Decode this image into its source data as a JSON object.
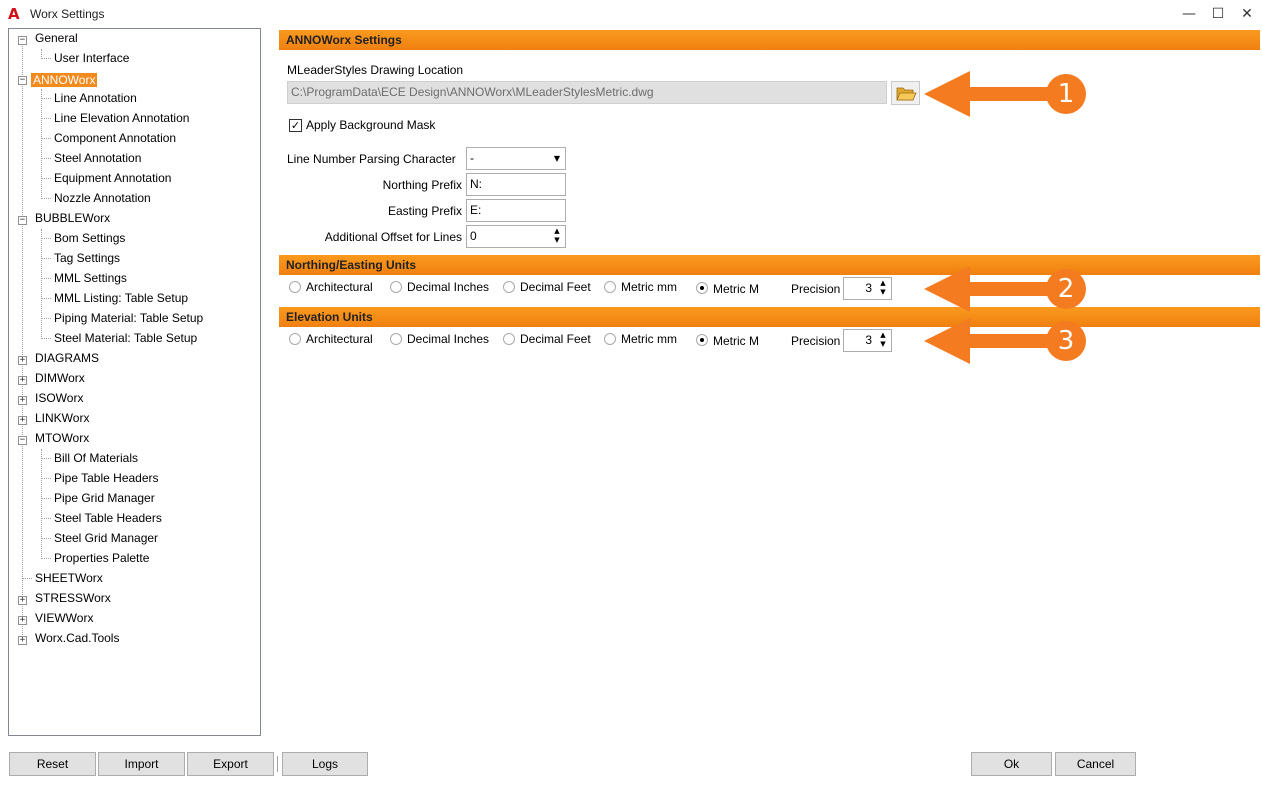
{
  "window": {
    "title": "Worx Settings",
    "app_icon": "A",
    "minimize": "—",
    "maximize": "☐",
    "close": "✕"
  },
  "tree": {
    "general": "General",
    "user_interface": "User Interface",
    "annoworx": "ANNOWorx",
    "anno_children": [
      "Line Annotation",
      "Line Elevation Annotation",
      "Component Annotation",
      "Steel Annotation",
      "Equipment Annotation",
      "Nozzle Annotation"
    ],
    "bubbleworx": "BUBBLEWorx",
    "bubble_children": [
      "Bom Settings",
      "Tag Settings",
      "MML Settings",
      "MML Listing: Table Setup",
      "Piping Material: Table Setup",
      "Steel Material: Table Setup"
    ],
    "diagrams": "DIAGRAMS",
    "dimworx": "DIMWorx",
    "isoworx": "ISOWorx",
    "linkworx": "LINKWorx",
    "mtoworx": "MTOWorx",
    "mto_children": [
      "Bill Of Materials",
      "Pipe Table Headers",
      "Pipe Grid Manager",
      "Steel Table Headers",
      "Steel Grid Manager",
      "Properties Palette"
    ],
    "sheetworx": "SHEETWorx",
    "stressworx": "STRESSWorx",
    "viewworx": "VIEWWorx",
    "worxcadtools": "Worx.Cad.Tools"
  },
  "settings": {
    "header": "ANNOWorx Settings",
    "mleader_label": "MLeaderStyles Drawing Location",
    "mleader_path": "C:\\ProgramData\\ECE Design\\ANNOWorx\\MLeaderStylesMetric.dwg",
    "apply_bg_mask": "Apply Background Mask",
    "apply_bg_mask_checked": true,
    "line_number_parsing_label": "Line Number Parsing Character",
    "line_number_parsing_value": "-",
    "northing_prefix_label": "Northing Prefix",
    "northing_prefix_value": "N:",
    "easting_prefix_label": "Easting Prefix",
    "easting_prefix_value": "E:",
    "offset_label": "Additional Offset for Lines",
    "offset_value": "0"
  },
  "northing_units": {
    "header": "Northing/Easting Units",
    "options": [
      "Architectural",
      "Decimal Inches",
      "Decimal Feet",
      "Metric mm",
      "Metric M"
    ],
    "selected": "Metric M",
    "precision_label": "Precision",
    "precision_value": "3"
  },
  "elevation_units": {
    "header": "Elevation Units",
    "options": [
      "Architectural",
      "Decimal Inches",
      "Decimal Feet",
      "Metric mm",
      "Metric M"
    ],
    "selected": "Metric M",
    "precision_label": "Precision",
    "precision_value": "3"
  },
  "callouts": [
    "1",
    "2",
    "3"
  ],
  "buttons": {
    "reset": "Reset",
    "import": "Import",
    "export": "Export",
    "logs": "Logs",
    "ok": "Ok",
    "cancel": "Cancel"
  },
  "colors": {
    "accent_orange": "#f47b20",
    "header_orange": "#f7911a",
    "selected_tree": "#f28a1e"
  },
  "icons": {
    "browse": "folder-open-icon",
    "combo": "chevron-down-icon",
    "spinner": "spin-up-down-icon",
    "expand": "plus-box-icon",
    "collapse": "minus-box-icon"
  }
}
